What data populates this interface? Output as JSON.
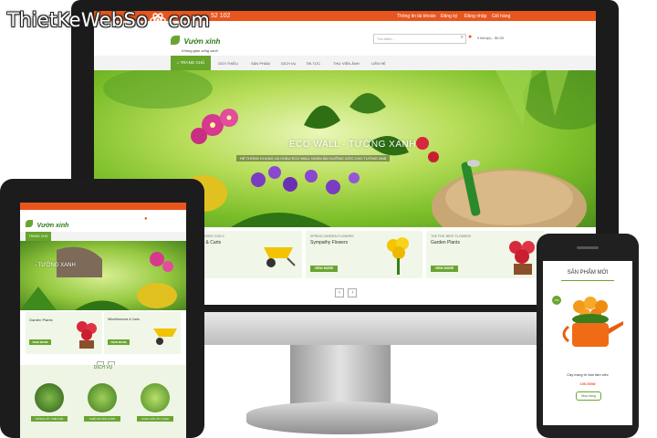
{
  "watermark": {
    "text_left": "ThietKeWebSo",
    "text_right": "com"
  },
  "desktop": {
    "topbar": {
      "phone": "52 102",
      "links": [
        "Thông tin tài khoản",
        "Đăng ký",
        "Đăng nhập",
        "Giỏ hàng"
      ]
    },
    "logo": {
      "name": "Vườn xinh",
      "tagline": "Không gian sống xanh"
    },
    "search": {
      "placeholder": "Tìm kiếm..."
    },
    "cart": {
      "label": "0 item(s) - $0.00"
    },
    "nav": {
      "home": "TRANG CHỦ",
      "items": [
        "GIỚI THIỆU",
        "SẢN PHẨM",
        "DỊCH VỤ",
        "TIN TỨC",
        "THƯ VIỆN ẢNH",
        "LIÊN HỆ"
      ]
    },
    "slide": {
      "title": "ECO WALL - TƯỜNG XANH",
      "subtitle": "HỆ THỐNG KHUNG VÀ CHẬU ECO WALL NGĂN ẤM DƯỠNG ƯỚC CHO TƯỜNG NHÀ"
    },
    "cards": [
      {
        "kicker": "GARDEN TOOLS",
        "title": "ws & Carts",
        "button": "VIEW MORE"
      },
      {
        "kicker": "SPRING GARDEN FLOWERS",
        "title": "Sympathy Flowers",
        "button": "VIEW MORE"
      },
      {
        "kicker": "THE FIVE BEST FLOWERS",
        "title": "Garden Plants",
        "button": "VIEW MORE"
      }
    ],
    "pager": {
      "prev": "‹",
      "next": "›"
    }
  },
  "tablet": {
    "logo": {
      "name": "Vườn xinh",
      "tagline": "Không gian sống xanh"
    },
    "nav": {
      "home": "TRANG CHỦ"
    },
    "slide": {
      "title": "- TƯỜNG XANH"
    },
    "cards": [
      {
        "title": "Garden Plants",
        "button": "VIEW MORE"
      },
      {
        "title": "Wheelbarrows & Carts",
        "button": "VIEW MORE"
      }
    ],
    "section_title": "DỊCH VỤ",
    "services": [
      "TRỒNG CÂY TRÊN MÁI",
      "THIẾT KẾ SÂN VƯỜN",
      "CUNG CẤP CÂY XANH"
    ]
  },
  "phone": {
    "section_title": "SẢN PHẨM MỚI",
    "badge": "-5%",
    "product_name": "Cây trang trí bàn làm việc",
    "price": "100.000đ",
    "button": "Mua hàng"
  },
  "colors": {
    "brand_green": "#6aa531",
    "topbar_orange": "#e8561e",
    "device_black": "#1b1b1b"
  }
}
